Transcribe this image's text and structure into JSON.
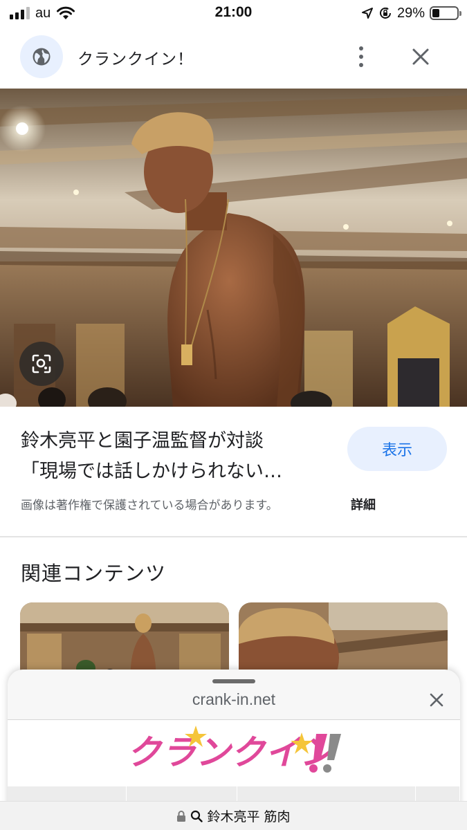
{
  "status_bar": {
    "carrier": "au",
    "time": "21:00",
    "battery_percent": "29%",
    "battery_level": 0.29,
    "icons": [
      "signal-icon",
      "wifi-icon",
      "location-icon",
      "orientation-lock-icon",
      "battery-icon"
    ]
  },
  "header": {
    "site_name": "クランクイン！",
    "icons": [
      "globe-icon",
      "more-vert-icon",
      "close-icon"
    ]
  },
  "image_caption": {
    "title_line1": "鈴木亮平と園子温監督が対談",
    "title_line2": "「現場では話しかけられない…",
    "view_button": "表示",
    "copyright_notice": "画像は著作権で保護されている場合があります。",
    "details_link": "詳細"
  },
  "related": {
    "heading": "関連コンテンツ"
  },
  "bottom_sheet": {
    "domain": "crank-in.net",
    "logo_text": "クランクイン!!",
    "colors": {
      "logo_pink": "#e0489a",
      "logo_star": "#f5c53a",
      "logo_gray": "#8a8a8a"
    }
  },
  "url_bar": {
    "query": "鈴木亮平 筋肉"
  },
  "colors": {
    "accent_blue": "#1a73e8",
    "button_bg": "#e8f0fe"
  }
}
